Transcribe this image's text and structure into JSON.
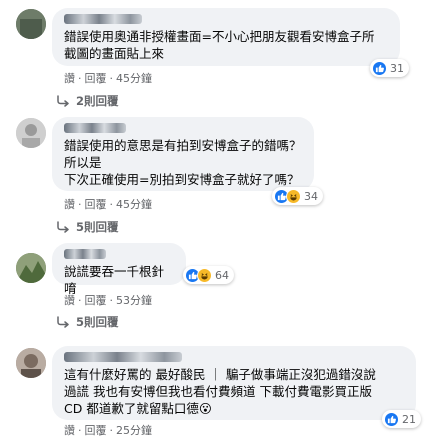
{
  "comments": [
    {
      "text": "錯誤使用奧通非授權畫面=不小心把朋友觀看安博盒子所\n截圖的畫面貼上來",
      "reaction_count": "31",
      "reactions": [
        "like-icon"
      ],
      "action_like": "讚",
      "action_reply": "回覆",
      "time": "45分鐘",
      "replies_label": "2則回覆",
      "avatar_color": "#5f6f5e"
    },
    {
      "text": "錯誤使用的意思是有拍到安博盒子的錯嗎？\n所以是\n下次正確使用=別拍到安博盒子就好了嗎？",
      "reaction_count": "34",
      "reactions": [
        "like-icon",
        "haha-icon"
      ],
      "action_like": "讚",
      "action_reply": "回覆",
      "time": "45分鐘",
      "replies_label": "5則回覆",
      "avatar_color": "#c7c7c7"
    },
    {
      "text": "說謊要吞一千根針唷",
      "reaction_count": "64",
      "reactions": [
        "like-icon",
        "haha-icon"
      ],
      "action_like": "讚",
      "action_reply": "回覆",
      "time": "53分鐘",
      "replies_label": "5則回覆",
      "avatar_color": "#7a8a6a"
    },
    {
      "text": "這有什麼好罵的 最好酸民 ｜ 騙子做事端正沒犯過錯沒說\n過謊 我也有安博但我也看付費頻道 下載付費電影買正版\nCD 都道歉了就留點口德😮",
      "reaction_count": "21",
      "reactions": [
        "like-icon"
      ],
      "action_like": "讚",
      "action_reply": "回覆",
      "time": "25分鐘",
      "avatar_color": "#9a8e86"
    }
  ],
  "colors": {
    "bubble": "#f0f2f5",
    "meta_text": "#65676b",
    "like_blue": "#1877f2",
    "haha_yellow": "#f7b928"
  }
}
